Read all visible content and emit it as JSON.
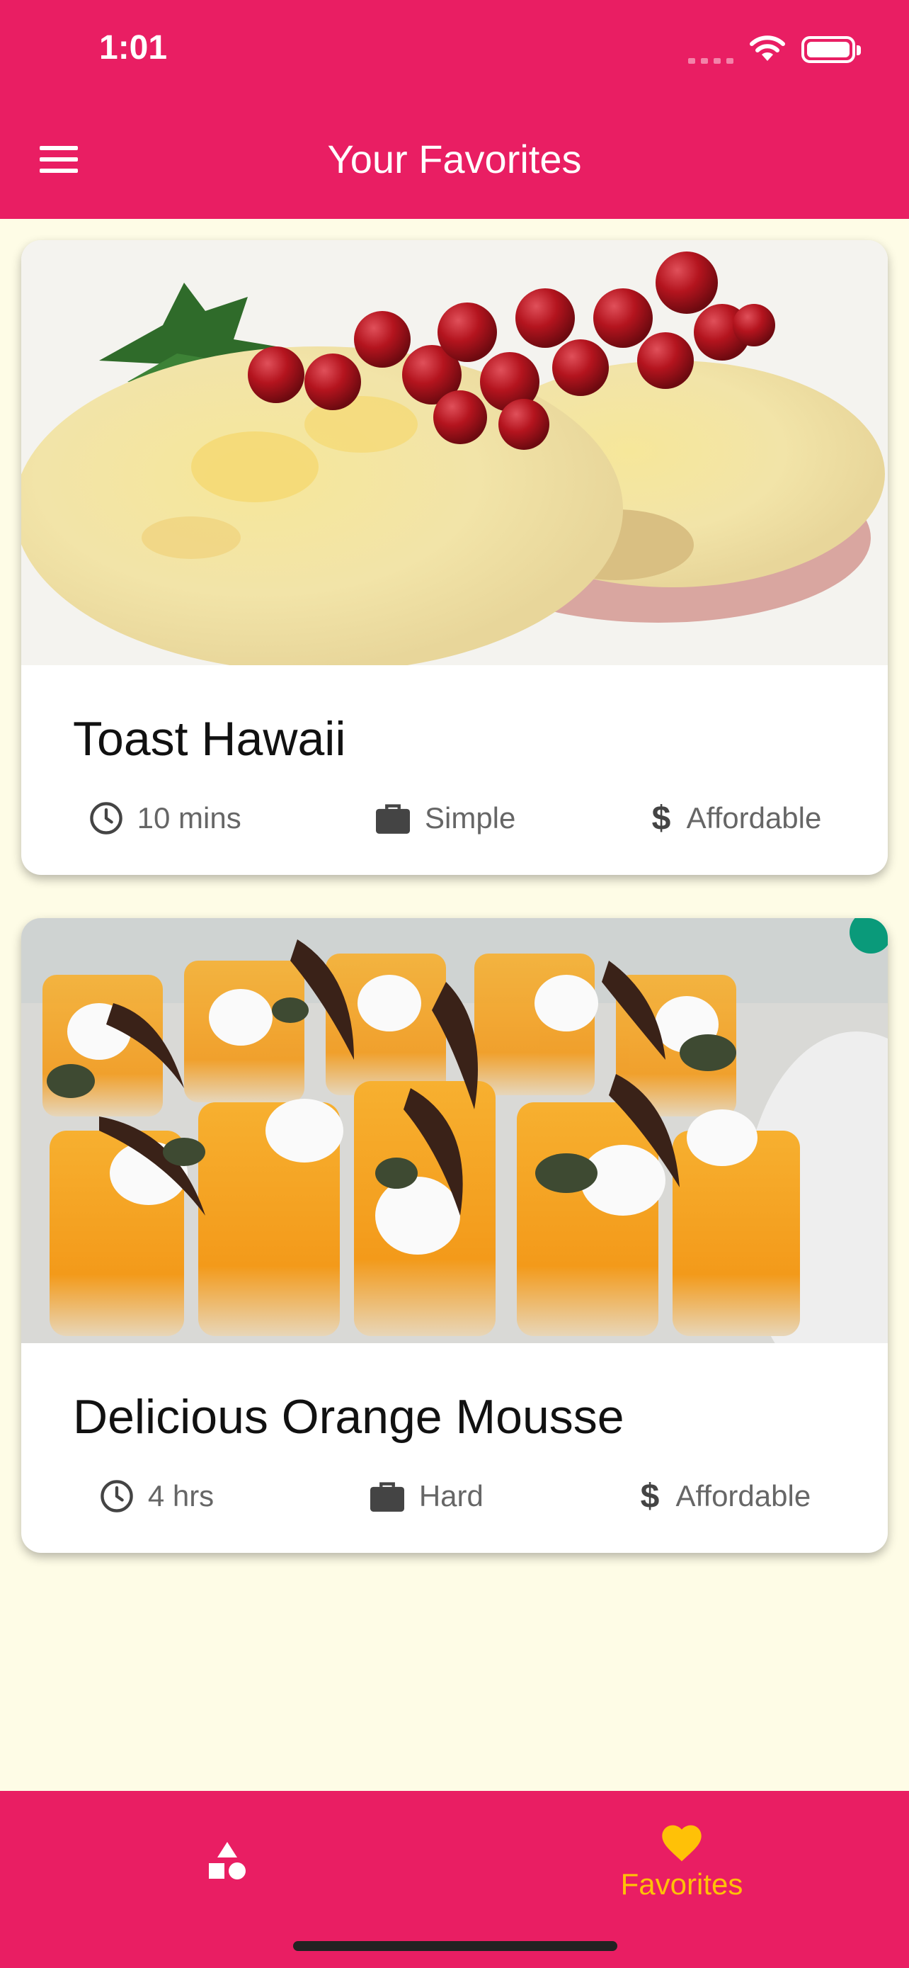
{
  "status_bar": {
    "time": "1:01"
  },
  "app_bar": {
    "title": "Your Favorites"
  },
  "meals": [
    {
      "title": "Toast Hawaii",
      "duration": "10 mins",
      "complexity": "Simple",
      "affordability": "Affordable"
    },
    {
      "title": "Delicious Orange Mousse",
      "duration": "4 hrs",
      "complexity": "Hard",
      "affordability": "Affordable"
    }
  ],
  "bottom_nav": {
    "categories_label": "",
    "favorites_label": "Favorites"
  },
  "colors": {
    "primary": "#e91e63",
    "accent": "#ffc107",
    "background": "#fefce6"
  }
}
